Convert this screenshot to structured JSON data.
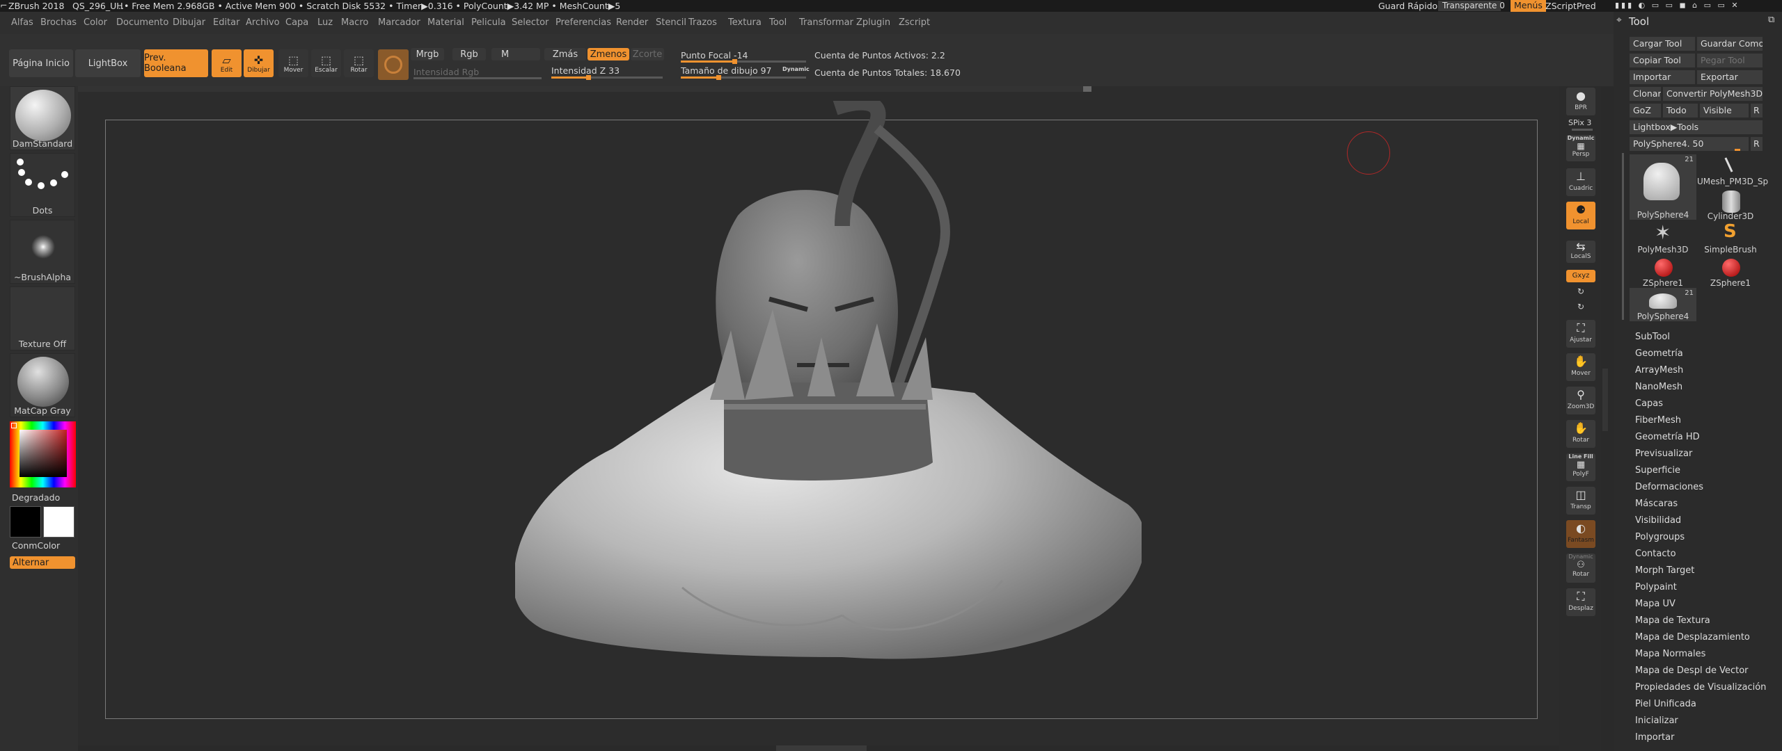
{
  "titlebar": {
    "app": "ZBrush 2018",
    "doc": "QS_296_UH",
    "mem": "..•  Free Mem 2.968GB • Active Mem 900 • Scratch Disk 5532 • Timer▶0.316 • PolyCount▶3.42 MP • MeshCount▶5",
    "guard": "Guard Rápido",
    "transparent": "Transparente 0",
    "menus": "Menús",
    "script": "ZScriptPred"
  },
  "menubar": [
    "Alfas",
    "Brochas",
    "Color",
    "Documento",
    "Dibujar",
    "Editar",
    "Archivo",
    "Capa",
    "Luz",
    "Macro",
    "Marcador",
    "Material",
    "Pelicula",
    "Selector",
    "Preferencias",
    "Render",
    "Stencil",
    "Trazos",
    "Textura",
    "Tool",
    "Transformar",
    "Zplugin",
    "Zscript"
  ],
  "toolbar": {
    "home": "Página Inicio",
    "lightbox": "LightBox",
    "boolean": "Prev. Booleana",
    "edit": "Edit",
    "draw": "Dibujar",
    "move": "Mover",
    "scale": "Escalar",
    "rotate": "Rotar",
    "mrgb": "Mrgb",
    "rgb": "Rgb",
    "m": "M",
    "zadd": "Zmás",
    "zsub": "Zmenos",
    "zcut": "Zcorte",
    "rgb_intensity": "Intensidad Rgb",
    "z_intensity": "Intensidad Z 33",
    "focal": "Punto Focal -14",
    "draw_size": "Tamaño de dibujo 97",
    "dynamic": "Dynamic",
    "active_points": "Cuenta de Puntos Activos: 2.283 M",
    "total_points": "Cuenta de Puntos Totales: 18.670",
    "z_intensity_level": 0.33,
    "focal_level": 0.43,
    "draw_size_level": 0.3
  },
  "leftshelf": {
    "brush": "DamStandard",
    "stroke": "Dots",
    "alpha": "~BrushAlpha",
    "texture": "Texture Off",
    "material": "MatCap Gray",
    "gradient": "Degradado",
    "concolor": "ConmColor",
    "alternate": "Alternar"
  },
  "rightshelf": {
    "bpr": "BPR",
    "spix": "SPix 3",
    "dynamic": "Dynamic",
    "persp": "Persp",
    "floor": "Cuadric",
    "local": "Local",
    "locals": "LocalS",
    "xyz": "Gxyz",
    "frame": "Ajustar",
    "move": "Mover",
    "zoom": "Zoom3D",
    "rotate": "Rotar",
    "linefill": "Line Fill",
    "polyf": "PolyF",
    "transp": "Transp",
    "ghost": "Fantasm",
    "dynamic2": "Dynamic",
    "solo": "Rotar",
    "xpose": "Desplaz"
  },
  "toolpanel": {
    "title": "Tool",
    "load": "Cargar Tool",
    "saveas": "Guardar Como",
    "copy": "Copiar Tool",
    "paste": "Pegar Tool",
    "import": "Importar",
    "export": "Exportar",
    "clone": "Clonar",
    "convert": "Convertir PolyMesh3D",
    "goz": "GoZ",
    "all": "Todo",
    "visible": "Visible",
    "r": "R",
    "lightbox": "Lightbox▶Tools",
    "current": "PolySphere4. 50",
    "r2": "R",
    "thumbs": [
      {
        "label": "PolySphere4",
        "count": "21"
      },
      {
        "label": "UMesh_PM3D_Sp",
        "count": ""
      },
      {
        "label": "Cylinder3D",
        "count": ""
      },
      {
        "label": "PolyMesh3D",
        "count": ""
      },
      {
        "label": "SimpleBrush",
        "count": ""
      },
      {
        "label": "ZSphere1",
        "count": ""
      },
      {
        "label": "ZSphere1",
        "count": ""
      },
      {
        "label": "PolySphere4",
        "count": "21"
      }
    ],
    "subpalettes": [
      "SubTool",
      "Geometría",
      "ArrayMesh",
      "NanoMesh",
      "Capas",
      "FiberMesh",
      "Geometría HD",
      "Previsualizar",
      "Superficie",
      "Deformaciones",
      "Máscaras",
      "Visibilidad",
      "Polygroups",
      "Contacto",
      "Morph Target",
      "Polypaint",
      "Mapa UV",
      "Mapa de Textura",
      "Mapa de Desplazamiento",
      "Mapa Normales",
      "Mapa de Despl de Vector",
      "Propiedades de Visualización",
      "Piel Unificada",
      "Inicializar",
      "Importar"
    ]
  },
  "colors": {
    "accent": "#f0922f",
    "bg": "#2a2a2a"
  }
}
